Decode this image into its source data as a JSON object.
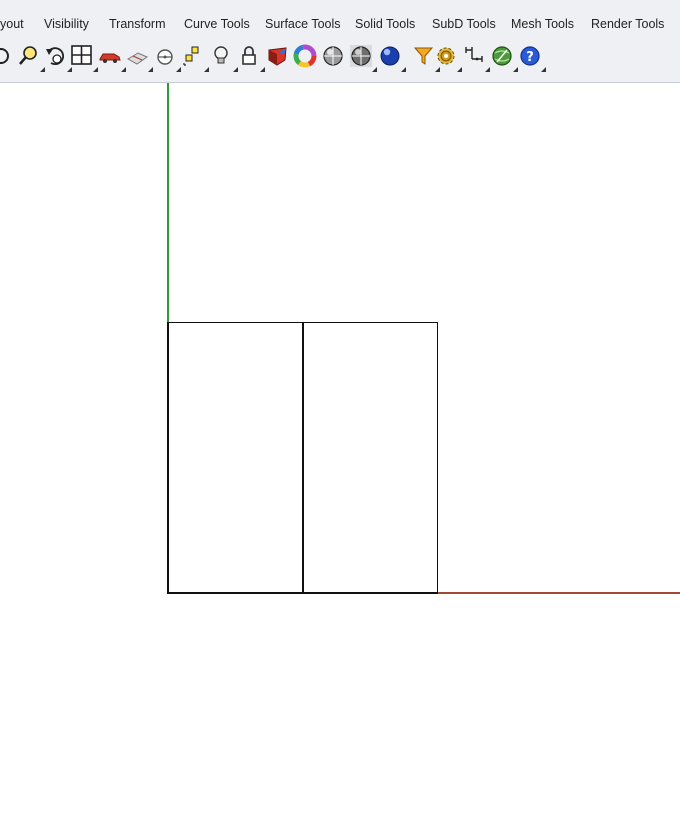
{
  "tabs": [
    {
      "id": "layout",
      "label": "yout"
    },
    {
      "id": "visibility",
      "label": "Visibility"
    },
    {
      "id": "transform",
      "label": "Transform"
    },
    {
      "id": "curve-tools",
      "label": "Curve Tools"
    },
    {
      "id": "surface-tools",
      "label": "Surface Tools"
    },
    {
      "id": "solid-tools",
      "label": "Solid Tools"
    },
    {
      "id": "subd-tools",
      "label": "SubD Tools"
    },
    {
      "id": "mesh-tools",
      "label": "Mesh Tools"
    },
    {
      "id": "render-tools",
      "label": "Render Tools"
    }
  ],
  "toolbar_icons": [
    "rotate-view-icon",
    "zoom-icon",
    "undo-view-icon",
    "four-viewports-icon",
    "car-icon",
    "plane-icon",
    "cplane-icon",
    "select-points-icon",
    "light-bulb-icon",
    "lock-icon",
    "material-icon",
    "color-wheel-icon",
    "shaded-sphere-icon",
    "rendered-sphere-icon",
    "blue-sphere-icon",
    "filter-icon",
    "gear-options-icon",
    "dimension-icon",
    "globe-render-icon",
    "help-icon"
  ],
  "colors": {
    "toolbar_bg": "#eef0f3",
    "y_axis": "#2f9a3c",
    "x_axis": "#a2493a",
    "geometry": "#111111"
  }
}
